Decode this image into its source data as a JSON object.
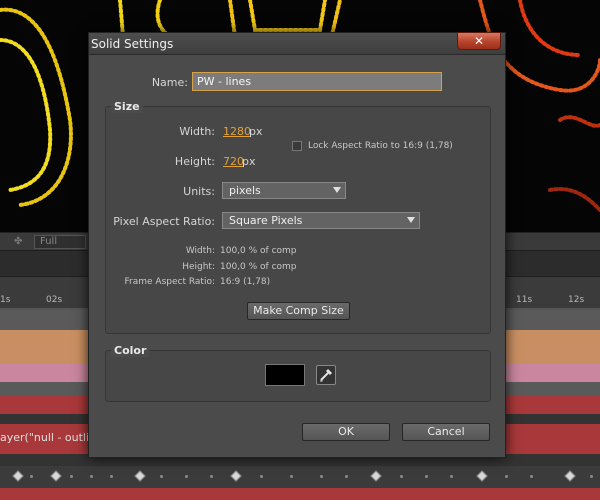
{
  "timeline": {
    "resolution": "Full",
    "ticks": [
      "1s",
      "02s",
      "11s",
      "12s"
    ],
    "expression_text": "ayer(\"null - outlin"
  },
  "dialog": {
    "title": "Solid Settings",
    "close_icon": "close-icon",
    "name_label": "Name:",
    "name_value": "PW - lines",
    "size_group": {
      "title": "Size",
      "width_label": "Width:",
      "width_value": "1280",
      "width_unit": "px",
      "height_label": "Height:",
      "height_value": "720",
      "height_unit": "px",
      "lock_label": "Lock Aspect Ratio to 16:9 (1,78)",
      "lock_checked": false,
      "units_label": "Units:",
      "units_value": "pixels",
      "par_label": "Pixel Aspect Ratio:",
      "par_value": "Square Pixels",
      "info_width_label": "Width:",
      "info_width_value": "100,0 % of comp",
      "info_height_label": "Height:",
      "info_height_value": "100,0 % of comp",
      "info_far_label": "Frame Aspect Ratio:",
      "info_far_value": "16:9 (1,78)",
      "make_comp_size": "Make Comp Size"
    },
    "color_group": {
      "title": "Color",
      "swatch_color": "#000000",
      "eyedropper_icon": "eyedropper-icon"
    },
    "ok_label": "OK",
    "cancel_label": "Cancel"
  },
  "colors": {
    "accent_value": "#e3a13a",
    "close_red": "#b8432c",
    "track_orange": "#c98f62",
    "track_pink": "#c9869e",
    "track_red": "#a8383a"
  }
}
